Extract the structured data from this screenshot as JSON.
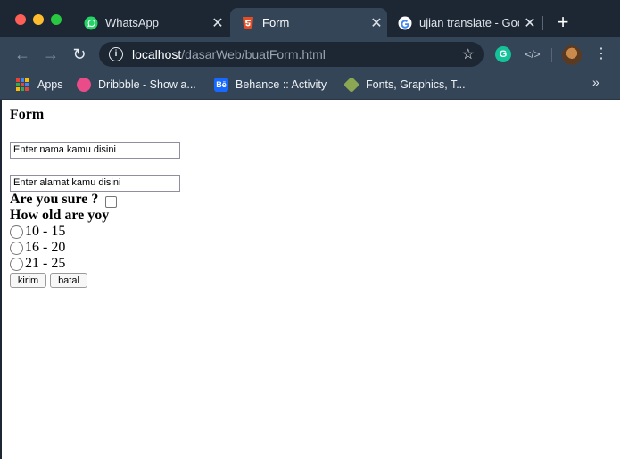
{
  "browser": {
    "tabs": [
      {
        "title": "WhatsApp",
        "icon": "whatsapp-icon",
        "active": false
      },
      {
        "title": "Form",
        "icon": "html5-icon",
        "active": true
      },
      {
        "title": "ujian translate - Goo",
        "icon": "google-icon",
        "active": false
      }
    ],
    "new_tab_label": "+",
    "url_host": "localhost",
    "url_path": "/dasarWeb/buatForm.html",
    "bookmarks": [
      {
        "label": "Apps",
        "icon": "apps-grid-icon"
      },
      {
        "label": "Dribbble - Show a...",
        "icon": "dribbble-icon"
      },
      {
        "label": "Behance :: Activity",
        "icon": "behance-icon"
      },
      {
        "label": "Fonts, Graphics, T...",
        "icon": "creative-market-icon"
      }
    ],
    "extensions": {
      "grammarly": "G",
      "code": "</>"
    }
  },
  "form": {
    "heading": "Form",
    "nama_value": "Enter nama kamu disini",
    "alamat_value": "Enter alamat kamu disini",
    "sure_label": "Are you sure ?",
    "age_question": "How old are yoy",
    "age_options": [
      "10 - 15",
      "16 - 20",
      "21 - 25"
    ],
    "submit_label": "kirim",
    "cancel_label": "batal"
  },
  "colors": {
    "frame": "#1d2733",
    "toolbar": "#354558",
    "page_bg": "#ffffff"
  }
}
